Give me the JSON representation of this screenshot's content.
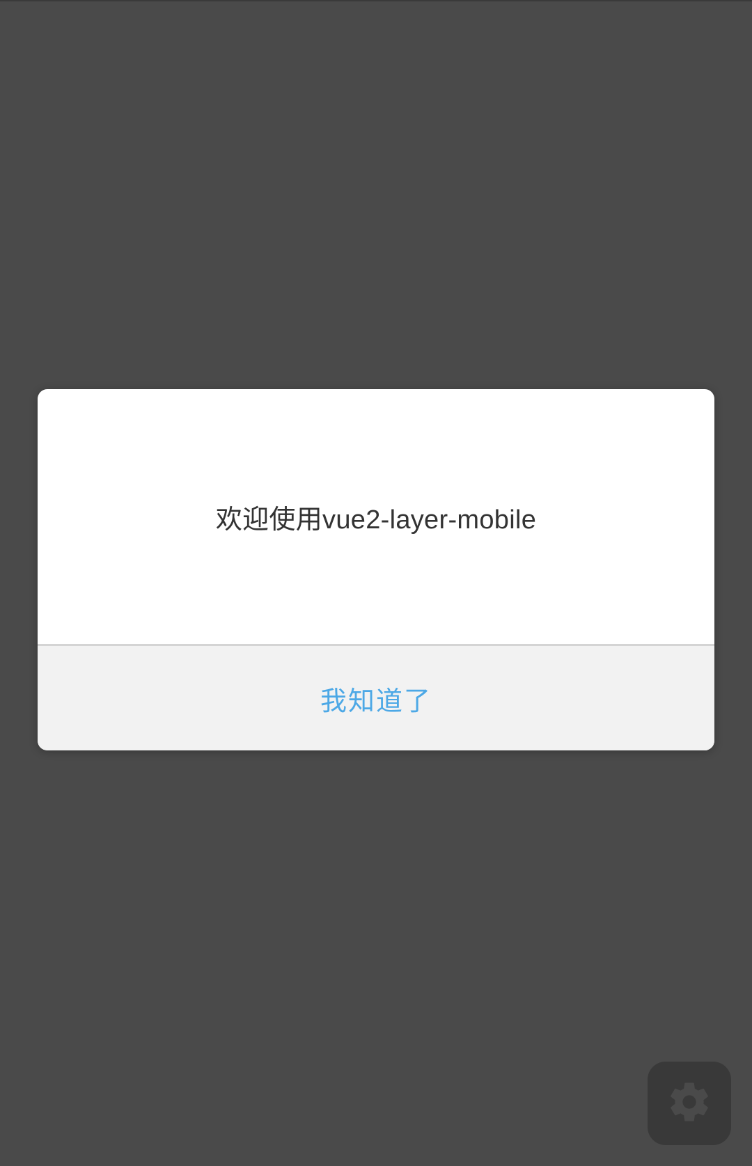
{
  "dialog": {
    "message": "欢迎使用vue2-layer-mobile",
    "confirm_label": "我知道了"
  },
  "colors": {
    "overlay": "#4a4a4a",
    "dialog_background": "#ffffff",
    "footer_background": "#f2f2f2",
    "message_text": "#333333",
    "confirm_text": "#4ca8e6",
    "settings_button_background": "#393939",
    "settings_icon": "#4a4a4a"
  },
  "icons": {
    "settings": "gear-icon"
  }
}
